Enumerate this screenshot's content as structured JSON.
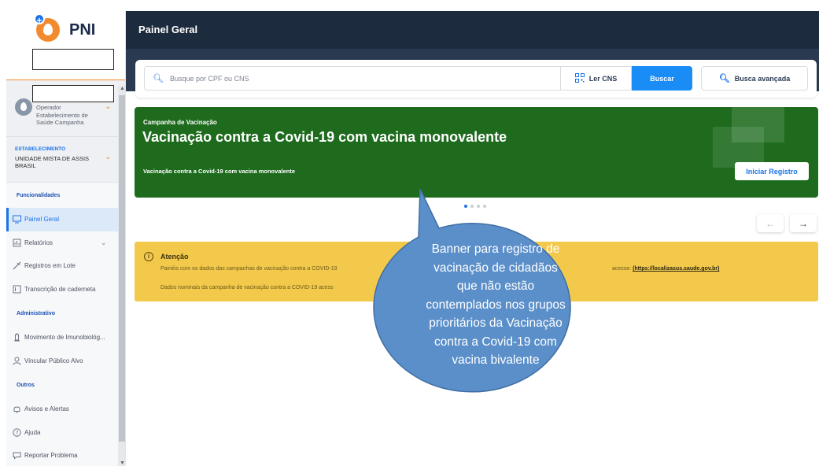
{
  "app": {
    "name": "PNI"
  },
  "sidebar": {
    "operator": {
      "role": "Operador",
      "unit_line1": "Estabelecimento de",
      "unit_line2": "Saúde Campanha"
    },
    "establishment": {
      "label": "ESTABELECIMENTO",
      "value": "UNIDADE MISTA DE ASSIS BRASIL"
    },
    "sections": {
      "funcionalidades": "Funcionalidades",
      "administrativo": "Administrativo",
      "outros": "Outros"
    },
    "items": {
      "painel_geral": "Painel Geral",
      "relatorios": "Relatórios",
      "registros_lote": "Registros em Lote",
      "transcricao": "Transcrição de caderneta",
      "movimento": "Movimento de Imunobiológ...",
      "vincular": "Vincular Público Alvo",
      "avisos": "Avisos e Alertas",
      "ajuda": "Ajuda",
      "reportar": "Reportar Problema"
    }
  },
  "header": {
    "title": "Painel Geral"
  },
  "search": {
    "placeholder": "Busque por CPF ou CNS",
    "ler_cns": "Ler CNS",
    "buscar": "Buscar",
    "busca_avancada": "Busca avançada"
  },
  "banner": {
    "kicker": "Campanha de Vacinação",
    "title": "Vacinação contra a Covid-19 com vacina monovalente",
    "subtitle": "Vacinação contra a Covid-19 com vacina monovalente",
    "button": "Iniciar Registro",
    "colors": {
      "background": "#1e6b1e"
    }
  },
  "carousel": {
    "total_slides": 4,
    "active_slide": 1
  },
  "alert": {
    "title": "Atenção",
    "line1": "Painéis com os dados das campanhas de vacinação contra a COVID-19",
    "link_prefix": "acesse:",
    "link": "(https://localizasus.saude.gov.br)",
    "line2": "Dados nominais da campanha de vacinação contra a COVID-19 acess",
    "colors": {
      "background": "#f3c94c"
    }
  },
  "callout": {
    "lines": [
      "Banner para registro de",
      "vacinação de cidadãos",
      "que não estão",
      "contemplados nos grupos",
      "prioritários da Vacinação",
      "contra a Covid-19 com",
      "vacina bivalente"
    ],
    "colors": {
      "fill": "#5b8fc9",
      "stroke": "#3f6ea4"
    }
  }
}
